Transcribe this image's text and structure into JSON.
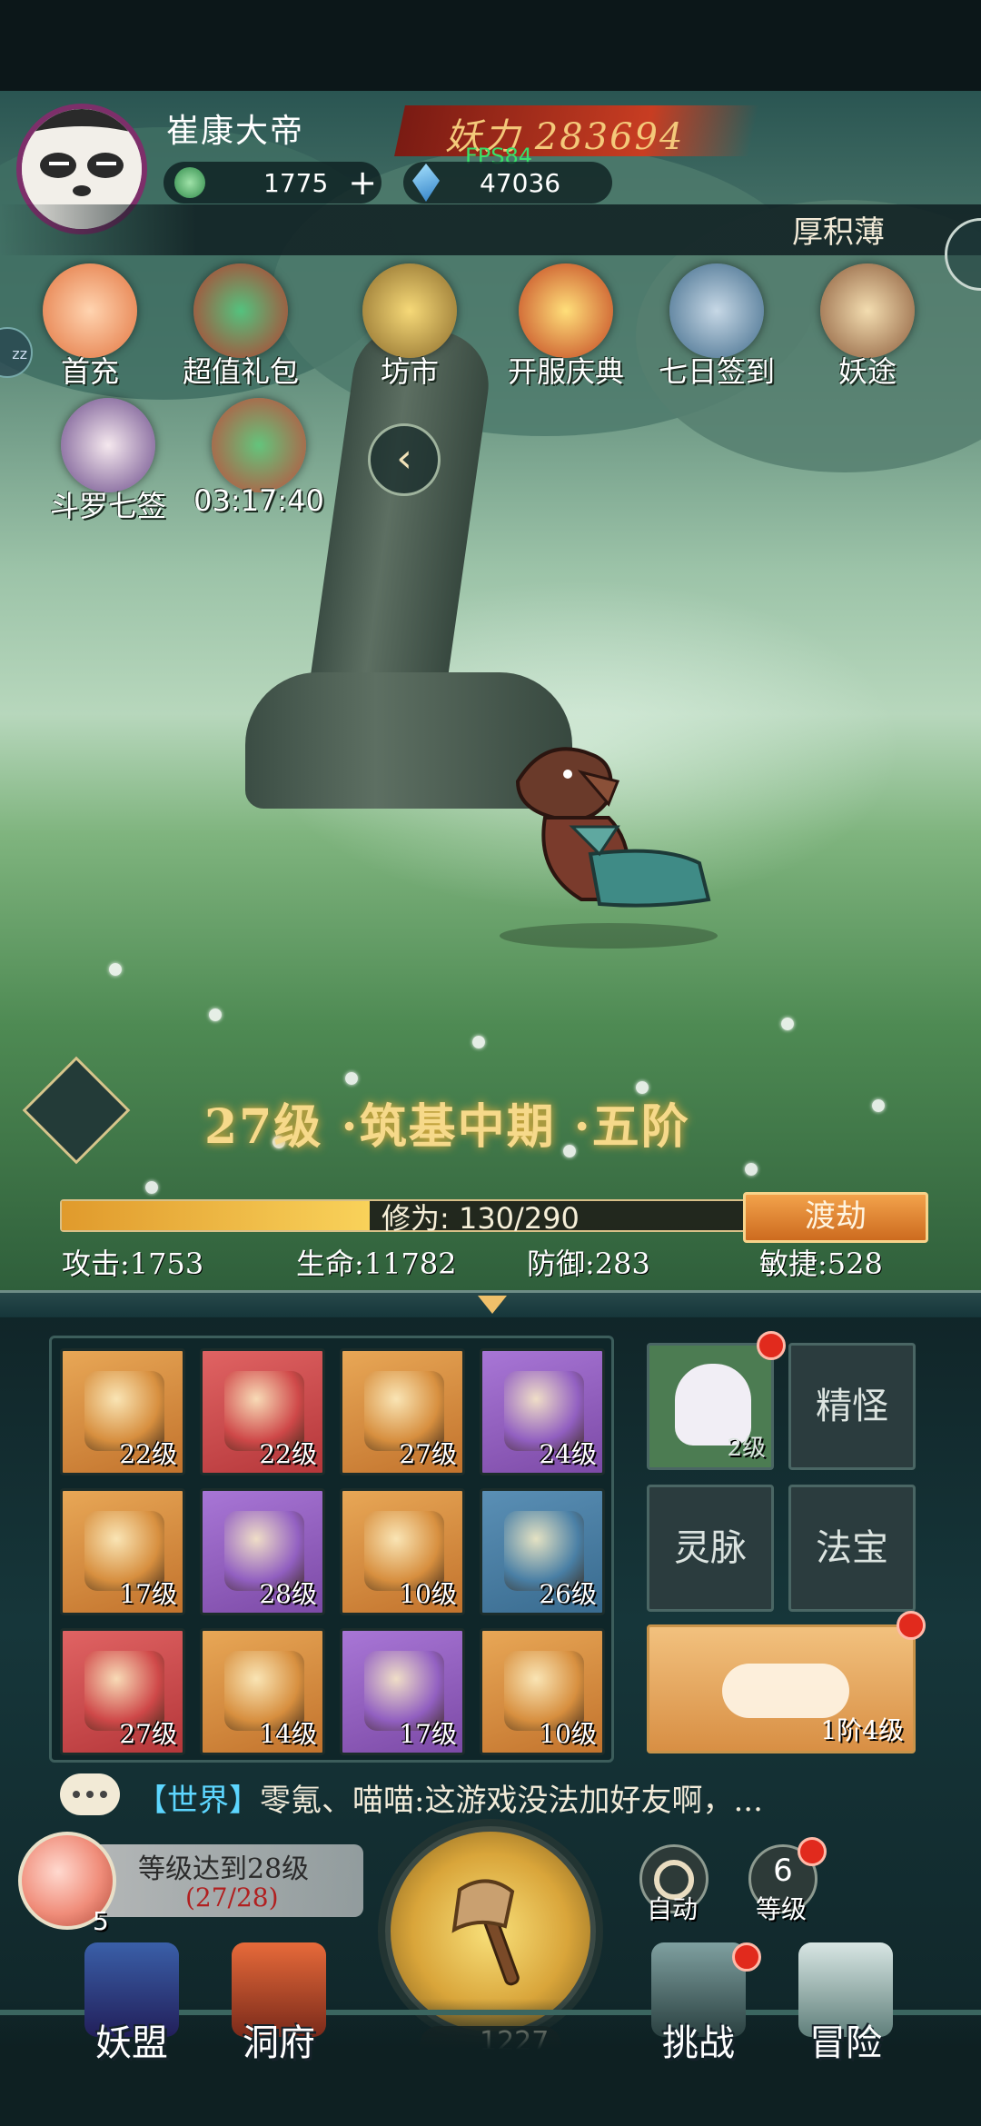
{
  "header": {
    "player_name": "崔康大帝",
    "power_label": "妖力",
    "power_value": "283694",
    "fps": "FPS84",
    "jade": "1775",
    "jade_plus": "+",
    "crystal": "47036",
    "banner_text": "厚积薄"
  },
  "activities": [
    {
      "label": "首充",
      "icon": "first-recharge-icon"
    },
    {
      "label": "超值礼包",
      "icon": "gift-bag-icon"
    },
    {
      "label": "坊市",
      "icon": "market-coin-icon"
    },
    {
      "label": "开服庆典",
      "icon": "celebration-giftbox-icon"
    },
    {
      "label": "七日签到",
      "icon": "seven-day-checkin-icon"
    },
    {
      "label": "妖途",
      "icon": "book-icon"
    },
    {
      "label": "斗罗七签",
      "icon": "character-portrait-icon"
    },
    {
      "label": "03:17:40",
      "icon": "timed-bag-icon"
    }
  ],
  "collapse_glyph": "‹",
  "level": {
    "text": "27级 ·筑基中期 ·五阶"
  },
  "xp": {
    "label": "修为: 130/290",
    "current": 130,
    "max": 290,
    "button": "渡劫"
  },
  "stats": {
    "attack": "攻击:1753",
    "hp": "生命:11782",
    "defense": "防御:283",
    "agility": "敏捷:528"
  },
  "equipment": [
    {
      "level": "22级",
      "quality": "orange",
      "icon": "sword-icon",
      "color": "#d8903f"
    },
    {
      "level": "22级",
      "quality": "red",
      "icon": "helmet-icon",
      "color": "#d04848"
    },
    {
      "level": "27级",
      "quality": "orange",
      "icon": "armor-icon",
      "color": "#d8903f"
    },
    {
      "level": "24级",
      "quality": "purple",
      "icon": "boots-icon",
      "color": "#9260c2"
    },
    {
      "level": "17级",
      "quality": "orange",
      "icon": "belt-icon",
      "color": "#d8903f"
    },
    {
      "level": "28级",
      "quality": "purple",
      "icon": "bracer-icon",
      "color": "#9260c2"
    },
    {
      "level": "10级",
      "quality": "orange",
      "icon": "orb-icon",
      "color": "#d8903f"
    },
    {
      "level": "26级",
      "quality": "blue",
      "icon": "necklace-icon",
      "color": "#4a80a6"
    },
    {
      "level": "27级",
      "quality": "red",
      "icon": "beast-mask-icon",
      "color": "#d04848"
    },
    {
      "level": "14级",
      "quality": "orange",
      "icon": "qilin-icon",
      "color": "#d8903f"
    },
    {
      "level": "17级",
      "quality": "purple",
      "icon": "bell-icon",
      "color": "#9260c2"
    },
    {
      "level": "10级",
      "quality": "orange",
      "icon": "golden-beast-icon",
      "color": "#d8903f"
    }
  ],
  "side": {
    "pet_level": "2级",
    "jingguai": "精怪",
    "lingmai": "灵脉",
    "fabao": "法宝",
    "cloud_level": "1阶4级"
  },
  "chat": {
    "channel": "【世界】",
    "message": "零氪、喵喵:这游戏没法加好友啊，..."
  },
  "quest": {
    "title": "等级达到28级",
    "progress": "(27/28)",
    "peach_count": "5"
  },
  "main_button": {
    "count": "1227",
    "auto_label": "自动",
    "level_label": "等级",
    "level_badge": "6"
  },
  "nav": {
    "alliance": "妖盟",
    "cave": "洞府",
    "challenge": "挑战",
    "adventure": "冒险"
  }
}
